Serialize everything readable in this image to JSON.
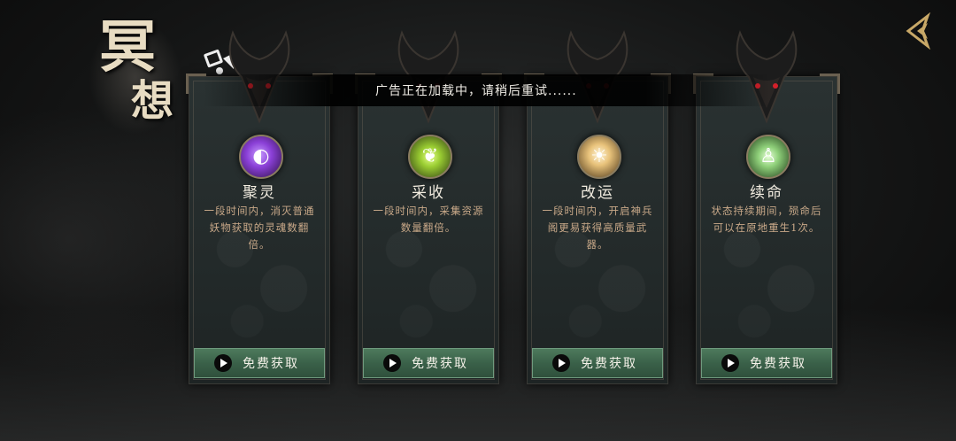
{
  "title": {
    "char1": "冥",
    "char2": "想"
  },
  "toast": {
    "message": "广告正在加载中，请稍后重试......"
  },
  "cards": [
    {
      "name": "聚灵",
      "desc": "一段时间内，消灭普通妖物获取的灵魂数翻倍。",
      "button": "免费获取",
      "orb_color": "#8a3fd6",
      "icon": "soul-orb-icon"
    },
    {
      "name": "采收",
      "desc": "一段时间内，采集资源数量翻倍。",
      "button": "免费获取",
      "orb_color": "#9acd32",
      "icon": "herb-icon"
    },
    {
      "name": "改运",
      "desc": "一段时间内，开启神兵阁更易获得高质量武器。",
      "button": "免费获取",
      "orb_color": "#e8c27a",
      "icon": "fortune-icon"
    },
    {
      "name": "续命",
      "desc": "状态持续期间，殒命后可以在原地重生1次。",
      "button": "免费获取",
      "orb_color": "#8fd07a",
      "icon": "revive-icon"
    }
  ],
  "colors": {
    "button_green": "#3a6149",
    "desc_text": "#c9a989",
    "card_bg": "#232a2a"
  }
}
